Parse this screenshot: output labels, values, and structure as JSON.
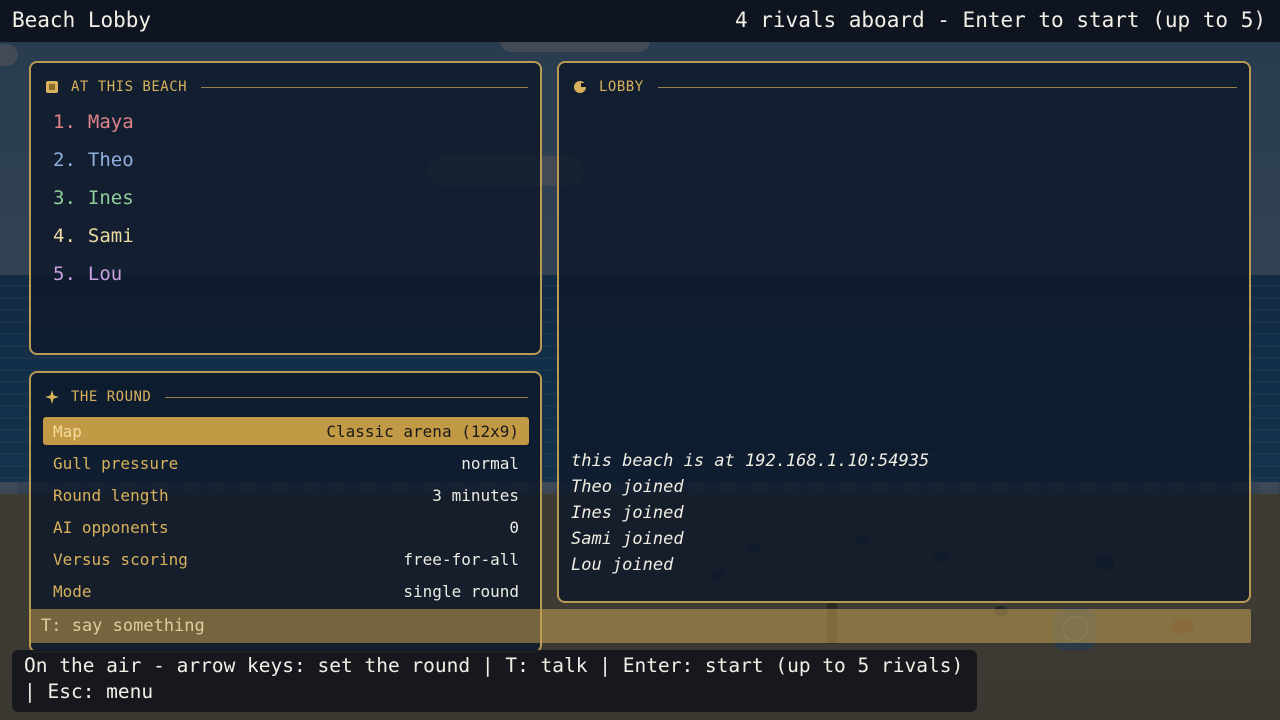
{
  "topbar": {
    "title": "Beach Lobby",
    "status": "4 rivals aboard - Enter to start (up to 5)"
  },
  "beach_panel": {
    "header": "AT THIS BEACH",
    "players": [
      {
        "num": "1.",
        "name": "Maya",
        "color": "#e0828a"
      },
      {
        "num": "2.",
        "name": "Theo",
        "color": "#8fb0de"
      },
      {
        "num": "3.",
        "name": "Ines",
        "color": "#8fcf9a"
      },
      {
        "num": "4.",
        "name": "Sami",
        "color": "#ecd9a0"
      },
      {
        "num": "5.",
        "name": "Lou",
        "color": "#c9a0e0"
      }
    ]
  },
  "round_panel": {
    "header": "THE ROUND",
    "settings": [
      {
        "label": "Map",
        "value": "Classic arena (12x9)",
        "selected": true
      },
      {
        "label": "Gull pressure",
        "value": "normal"
      },
      {
        "label": "Round length",
        "value": "3 minutes"
      },
      {
        "label": "AI opponents",
        "value": "0"
      },
      {
        "label": "Versus scoring",
        "value": "free-for-all"
      },
      {
        "label": "Mode",
        "value": "single round"
      }
    ]
  },
  "lobby_panel": {
    "header": "LOBBY",
    "log": [
      "this beach is at 192.168.1.10:54935",
      "Theo joined",
      "Ines joined",
      "Sami joined",
      "Lou joined"
    ]
  },
  "chat": {
    "placeholder": "T: say something"
  },
  "help_bar": {
    "text": "On the air - arrow keys: set the round | T: talk | Enter: start (up to 5 rivals) | Esc: menu"
  },
  "colors": {
    "accent": "#d8b15c",
    "panel_border": "#b99a55",
    "selected_row": "#c29a45"
  }
}
